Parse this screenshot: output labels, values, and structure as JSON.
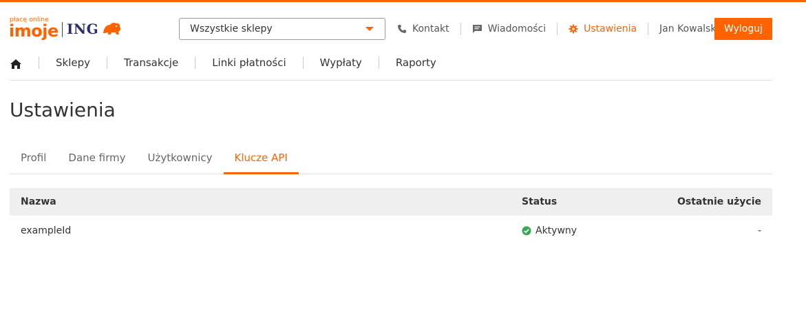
{
  "brand": {
    "tagline": "płacę online",
    "product": "imoje",
    "bank": "ING"
  },
  "header": {
    "store_select": {
      "value": "Wszystkie sklepy"
    },
    "nav": [
      {
        "label": "Kontakt",
        "icon": "phone-icon"
      },
      {
        "label": "Wiadomości",
        "icon": "message-icon"
      },
      {
        "label": "Ustawienia",
        "icon": "gear-icon",
        "active": true
      },
      {
        "label": "Jan Kowalski"
      }
    ],
    "logout_label": "Wyloguj"
  },
  "mainnav": {
    "home_icon": "home-icon",
    "items": [
      "Sklepy",
      "Transakcje",
      "Linki płatności",
      "Wypłaty",
      "Raporty"
    ]
  },
  "page": {
    "title": "Ustawienia",
    "tabs": [
      {
        "label": "Profil"
      },
      {
        "label": "Dane firmy"
      },
      {
        "label": "Użytkownicy"
      },
      {
        "label": "Klucze API",
        "active": true
      }
    ]
  },
  "table": {
    "columns": [
      "Nazwa",
      "Status",
      "Ostatnie użycie"
    ],
    "rows": [
      {
        "name": "exampleId",
        "status": "Aktywny",
        "status_icon": "check-circle-icon",
        "last_used": "-"
      }
    ]
  },
  "colors": {
    "accent": "#ff6200",
    "status_ok": "#34a853",
    "bank_navy": "#2b2b6e"
  }
}
